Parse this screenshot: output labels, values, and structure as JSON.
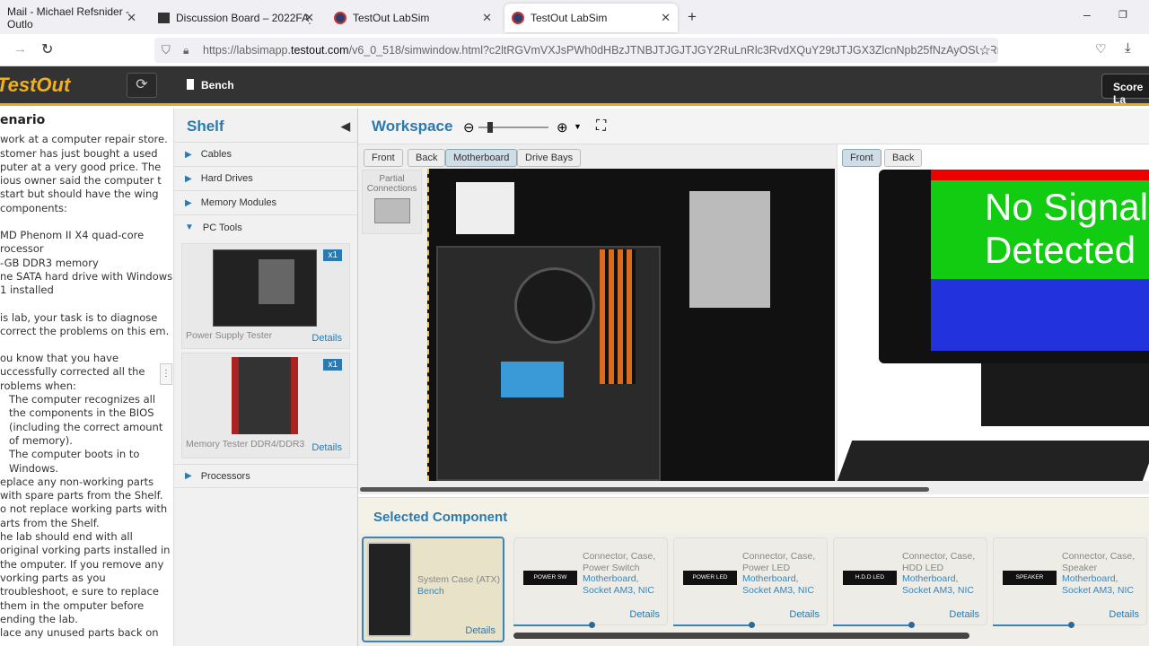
{
  "browser": {
    "tabs": [
      {
        "label": "Mail - Michael Refsnider - Outlo"
      },
      {
        "label": "Discussion Board – 2022FA_CIS"
      },
      {
        "label": "TestOut LabSim"
      },
      {
        "label": "TestOut LabSim",
        "active": true
      }
    ],
    "url_host": "https://labsimapp.",
    "url_domain": "testout.com",
    "url_rest": "/v6_0_518/simwindow.html?c2ltRGVmVXJsPWh0dHBzJTNBJTJGJTJGY2RuLnRlc3RvdXQuY29tJTJGX3ZlcnNpb25fNzAyOSUyRnBjcHJvJ"
  },
  "app": {
    "logo": "TestOut",
    "bench_label": "Bench",
    "score_label": "Score La"
  },
  "scenario": {
    "title": "enario",
    "paragraphs": [
      "work at a computer repair store. stomer has just bought a used puter at a very good price. The ious owner said the computer t start but should have the wing components:",
      "MD Phenom II X4 quad-core rocessor",
      "-GB DDR3 memory",
      "ne SATA hard drive with Windows 1 installed",
      "is lab, your task is to diagnose correct the problems on this em.",
      "ou know that you have uccessfully corrected all the roblems when:",
      "The computer recognizes all the components in the BIOS (including the correct amount of memory).",
      "The computer boots in to Windows.",
      "eplace any non-working parts with spare parts from the Shelf.",
      "o not replace working parts with arts from the Shelf.",
      "he lab should end with all original vorking parts installed in the omputer. If you remove any vorking parts as you troubleshoot, e sure to replace them in the omputer before ending the lab.",
      "lace any unused parts back on"
    ]
  },
  "shelf": {
    "title": "Shelf",
    "categories": [
      "Cables",
      "Hard Drives",
      "Memory Modules",
      "PC Tools",
      "Processors"
    ],
    "items": [
      {
        "name": "Power Supply Tester",
        "qty": "x1",
        "details": "Details"
      },
      {
        "name": "Memory Tester DDR4/DDR3",
        "qty": "x1",
        "details": "Details"
      }
    ]
  },
  "workspace": {
    "title": "Workspace",
    "left_views": [
      "Front",
      "Back",
      "Motherboard",
      "Drive Bays"
    ],
    "selected_view": "Motherboard",
    "right_views": [
      "Front",
      "Back"
    ],
    "partial_connections": "Partial Connections",
    "monitor_text": "No Signal Detected"
  },
  "selected": {
    "title": "Selected Component",
    "details": "Details",
    "items": [
      {
        "name": "System Case (ATX)",
        "loc": "Bench"
      },
      {
        "name": "Connector, Case, Power Switch",
        "loc": "Motherboard, Socket AM3, NIC",
        "img": "POWER SW"
      },
      {
        "name": "Connector, Case, Power LED",
        "loc": "Motherboard, Socket AM3, NIC",
        "img": "POWER LED"
      },
      {
        "name": "Connector, Case, HDD LED",
        "loc": "Motherboard, Socket AM3, NIC",
        "img": "H.D.D LED"
      },
      {
        "name": "Connector, Case, Speaker",
        "loc": "Motherboard, Socket AM3, NIC",
        "img": "SPEAKER"
      }
    ]
  }
}
